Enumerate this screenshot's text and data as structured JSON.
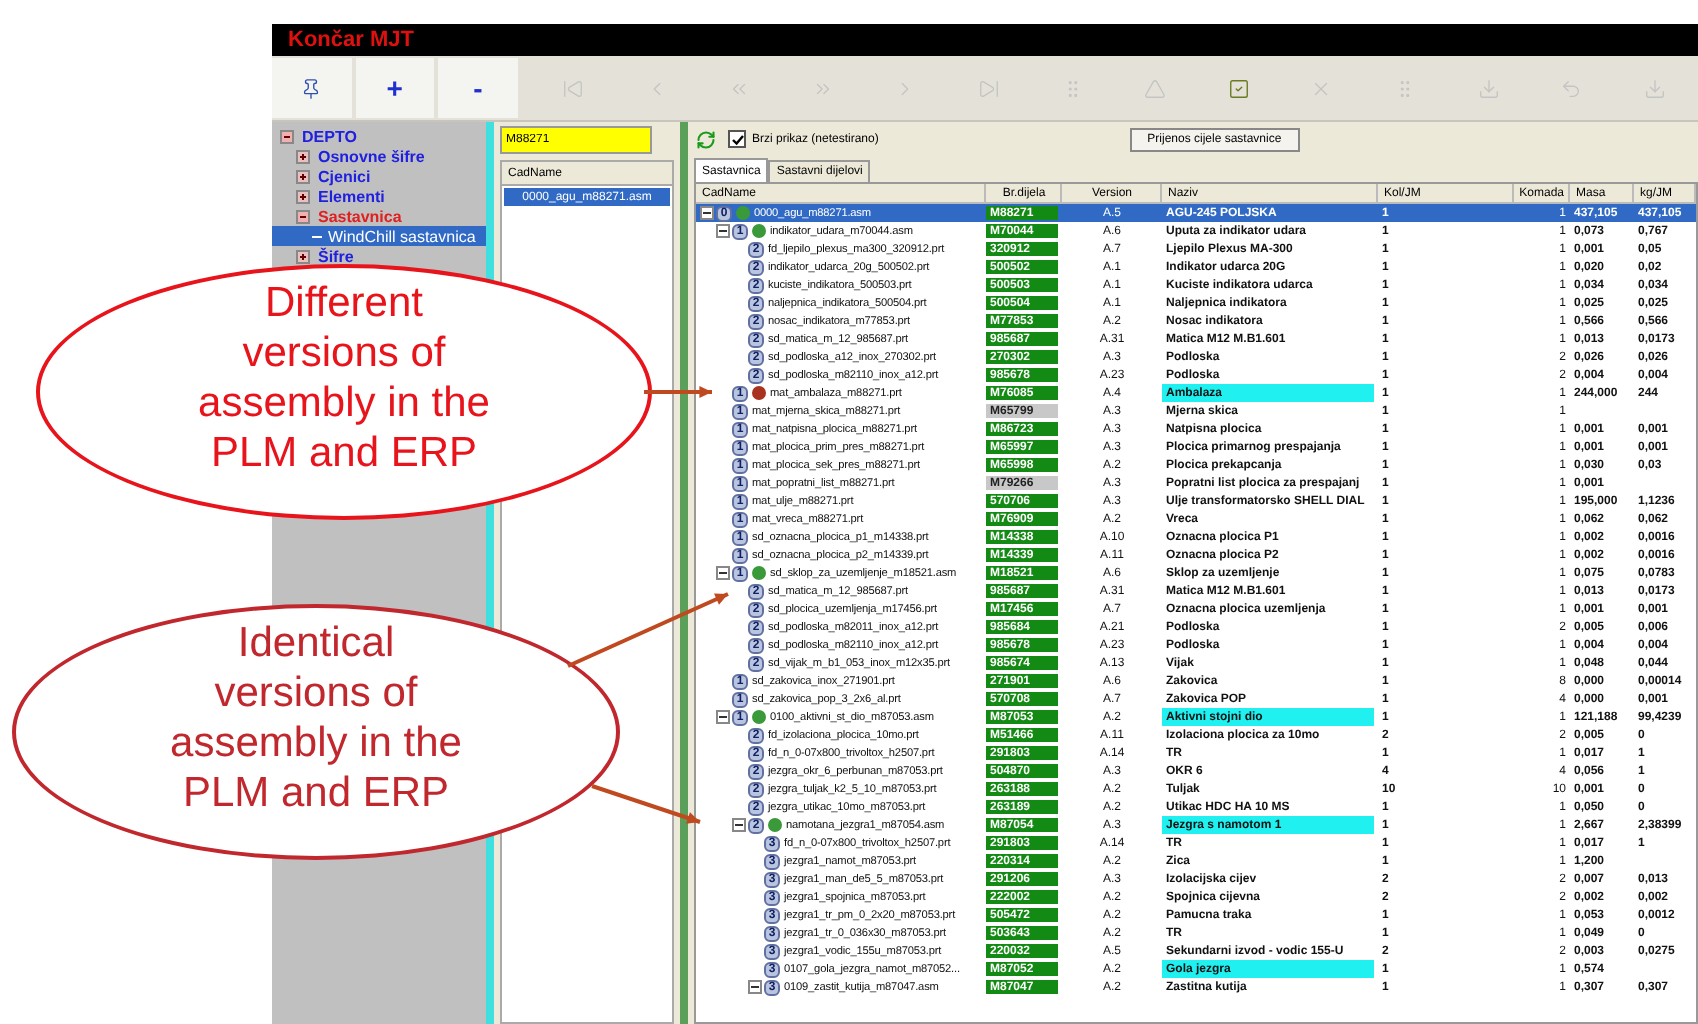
{
  "window": {
    "title": "Končar MJT"
  },
  "toolbar": [
    {
      "kind": "icon",
      "disabled": false
    },
    {
      "kind": "text",
      "label": "+",
      "disabled": false
    },
    {
      "kind": "text",
      "label": "-",
      "disabled": false
    },
    {
      "kind": "icon",
      "disabled": true
    },
    {
      "kind": "icon",
      "disabled": true
    },
    {
      "kind": "icon",
      "disabled": true
    },
    {
      "kind": "icon",
      "disabled": true
    },
    {
      "kind": "icon",
      "disabled": true
    },
    {
      "kind": "icon",
      "disabled": true
    },
    {
      "kind": "icon",
      "disabled": true
    },
    {
      "kind": "icon",
      "disabled": true
    },
    {
      "kind": "icon",
      "disabled": false
    },
    {
      "kind": "icon",
      "disabled": true
    },
    {
      "kind": "icon",
      "disabled": true
    },
    {
      "kind": "icon",
      "disabled": true
    },
    {
      "kind": "icon",
      "disabled": true
    },
    {
      "kind": "icon",
      "disabled": true
    }
  ],
  "tree": [
    {
      "label": "DEPTO",
      "expanded": true,
      "selected": false,
      "children": [
        {
          "label": "Osnovne šifre",
          "expanded": false,
          "selected": false
        },
        {
          "label": "Cjenici",
          "expanded": false,
          "selected": false
        },
        {
          "label": "Elementi",
          "expanded": false,
          "selected": false
        },
        {
          "label": "Sastavnica",
          "expanded": true,
          "selected": false,
          "active": true,
          "children": [
            {
              "label": "WindChill sastavnica",
              "selected": true
            }
          ]
        },
        {
          "label": "Šifre",
          "expanded": false,
          "selected": false
        }
      ]
    }
  ],
  "search": {
    "value": "M88271"
  },
  "file_list": {
    "header": "CadName",
    "items": [
      {
        "label": "0000_agu_m88271.asm",
        "selected": true
      }
    ]
  },
  "options": {
    "fast_view": {
      "label": "Brzi prikaz (netestirano)",
      "checked": true
    },
    "transfer_button": "Prijenos cijele sastavnice"
  },
  "tabs": [
    {
      "label": "Sastavnica",
      "selected": true
    },
    {
      "label": "Sastavni dijelovi",
      "selected": false
    }
  ],
  "table": {
    "columns": [
      "CadName",
      "Br.dijela",
      "Version",
      "Naziv",
      "Kol/JM",
      "Komada",
      "Masa",
      "kg/JM"
    ],
    "rows": [
      {
        "badge": "0",
        "cad_name": "0000_agu_m88271.asm",
        "part_no": "M88271",
        "version": "A.5",
        "name": "AGU-245 POLJSKA",
        "qty_uom": "1",
        "pieces": "1",
        "mass": "437,105",
        "kg_per_uom": "437,105",
        "in_erp": true,
        "highlighted": false,
        "selected": true,
        "expanded": true,
        "color": "#3a9a3a",
        "children": [
          {
            "badge": "1",
            "cad_name": "indikator_udara_m70044.asm",
            "part_no": "M70044",
            "version": "A.6",
            "name": "Uputa za indikator udara",
            "qty_uom": "1",
            "pieces": "1",
            "mass": "0,073",
            "kg_per_uom": "0,767",
            "in_erp": true,
            "highlighted": false,
            "selected": false,
            "expanded": true,
            "color": "#3a9a3a",
            "children": [
              {
                "badge": "2",
                "cad_name": "fd_ljepilo_plexus_ma300_320912.prt",
                "part_no": "320912",
                "version": "A.7",
                "name": "Ljepilo Plexus MA-300",
                "qty_uom": "1",
                "pieces": "1",
                "mass": "0,001",
                "kg_per_uom": "0,05",
                "in_erp": true,
                "highlighted": false,
                "selected": false
              },
              {
                "badge": "2",
                "cad_name": "indikator_udarca_20g_500502.prt",
                "part_no": "500502",
                "version": "A.1",
                "name": "Indikator udarca 20G",
                "qty_uom": "1",
                "pieces": "1",
                "mass": "0,020",
                "kg_per_uom": "0,02",
                "in_erp": true,
                "highlighted": false,
                "selected": false
              },
              {
                "badge": "2",
                "cad_name": "kuciste_indikatora_500503.prt",
                "part_no": "500503",
                "version": "A.1",
                "name": "Kuciste indikatora udarca",
                "qty_uom": "1",
                "pieces": "1",
                "mass": "0,034",
                "kg_per_uom": "0,034",
                "in_erp": true,
                "highlighted": false,
                "selected": false
              },
              {
                "badge": "2",
                "cad_name": "naljepnica_indikatora_500504.prt",
                "part_no": "500504",
                "version": "A.1",
                "name": "Naljepnica indikatora",
                "qty_uom": "1",
                "pieces": "1",
                "mass": "0,025",
                "kg_per_uom": "0,025",
                "in_erp": true,
                "highlighted": false,
                "selected": false
              },
              {
                "badge": "2",
                "cad_name": "nosac_indikatora_m77853.prt",
                "part_no": "M77853",
                "version": "A.2",
                "name": "Nosac indikatora",
                "qty_uom": "1",
                "pieces": "1",
                "mass": "0,566",
                "kg_per_uom": "0,566",
                "in_erp": true,
                "highlighted": false,
                "selected": false
              },
              {
                "badge": "2",
                "cad_name": "sd_matica_m_12_985687.prt",
                "part_no": "985687",
                "version": "A.31",
                "name": "Matica M12 M.B1.601",
                "qty_uom": "1",
                "pieces": "1",
                "mass": "0,013",
                "kg_per_uom": "0,0173",
                "in_erp": true,
                "highlighted": false,
                "selected": false
              },
              {
                "badge": "2",
                "cad_name": "sd_podloska_a12_inox_270302.prt",
                "part_no": "270302",
                "version": "A.3",
                "name": "Podloska",
                "qty_uom": "1",
                "pieces": "2",
                "mass": "0,026",
                "kg_per_uom": "0,026",
                "in_erp": true,
                "highlighted": false,
                "selected": false
              },
              {
                "badge": "2",
                "cad_name": "sd_podloska_m82110_inox_a12.prt",
                "part_no": "985678",
                "version": "A.23",
                "name": "Podloska",
                "qty_uom": "1",
                "pieces": "2",
                "mass": "0,004",
                "kg_per_uom": "0,004",
                "in_erp": true,
                "highlighted": false,
                "selected": false
              }
            ]
          },
          {
            "badge": "1",
            "cad_name": "mat_ambalaza_m88271.prt",
            "part_no": "M76085",
            "version": "A.4",
            "name": "Ambalaza",
            "qty_uom": "1",
            "pieces": "1",
            "mass": "244,000",
            "kg_per_uom": "244",
            "in_erp": true,
            "highlighted": true,
            "selected": false,
            "color": "#a8321e"
          },
          {
            "badge": "1",
            "cad_name": "mat_mjerna_skica_m88271.prt",
            "part_no": "M65799",
            "version": "A.3",
            "name": "Mjerna skica",
            "qty_uom": "1",
            "pieces": "1",
            "in_erp": false,
            "highlighted": false,
            "selected": false
          },
          {
            "badge": "1",
            "cad_name": "mat_natpisna_plocica_m88271.prt",
            "part_no": "M86723",
            "version": "A.3",
            "name": "Natpisna plocica",
            "qty_uom": "1",
            "pieces": "1",
            "mass": "0,001",
            "kg_per_uom": "0,001",
            "in_erp": true,
            "highlighted": false,
            "selected": false
          },
          {
            "badge": "1",
            "cad_name": "mat_plocica_prim_pres_m88271.prt",
            "part_no": "M65997",
            "version": "A.3",
            "name": "Plocica primarnog prespajanja",
            "qty_uom": "1",
            "pieces": "1",
            "mass": "0,001",
            "kg_per_uom": "0,001",
            "in_erp": true,
            "highlighted": false,
            "selected": false
          },
          {
            "badge": "1",
            "cad_name": "mat_plocica_sek_pres_m88271.prt",
            "part_no": "M65998",
            "version": "A.2",
            "name": "Plocica prekapcanja",
            "qty_uom": "1",
            "pieces": "1",
            "mass": "0,030",
            "kg_per_uom": "0,03",
            "in_erp": true,
            "highlighted": false,
            "selected": false
          },
          {
            "badge": "1",
            "cad_name": "mat_popratni_list_m88271.prt",
            "part_no": "M79266",
            "version": "A.3",
            "name": "Popratni list plocica za prespajanj",
            "qty_uom": "1",
            "pieces": "1",
            "mass": "0,001",
            "in_erp": false,
            "highlighted": false,
            "selected": false
          },
          {
            "badge": "1",
            "cad_name": "mat_ulje_m88271.prt",
            "part_no": "570706",
            "version": "A.3",
            "name": "Ulje transformatorsko SHELL DIAL",
            "qty_uom": "1",
            "pieces": "1",
            "mass": "195,000",
            "kg_per_uom": "1,1236",
            "in_erp": true,
            "highlighted": false,
            "selected": false
          },
          {
            "badge": "1",
            "cad_name": "mat_vreca_m88271.prt",
            "part_no": "M76909",
            "version": "A.2",
            "name": "Vreca",
            "qty_uom": "1",
            "pieces": "1",
            "mass": "0,062",
            "kg_per_uom": "0,062",
            "in_erp": true,
            "highlighted": false,
            "selected": false
          },
          {
            "badge": "1",
            "cad_name": "sd_oznacna_plocica_p1_m14338.prt",
            "part_no": "M14338",
            "version": "A.10",
            "name": "Oznacna plocica P1",
            "qty_uom": "1",
            "pieces": "1",
            "mass": "0,002",
            "kg_per_uom": "0,0016",
            "in_erp": true,
            "highlighted": false,
            "selected": false
          },
          {
            "badge": "1",
            "cad_name": "sd_oznacna_plocica_p2_m14339.prt",
            "part_no": "M14339",
            "version": "A.11",
            "name": "Oznacna plocica P2",
            "qty_uom": "1",
            "pieces": "1",
            "mass": "0,002",
            "kg_per_uom": "0,0016",
            "in_erp": true,
            "highlighted": false,
            "selected": false
          },
          {
            "badge": "1",
            "cad_name": "sd_sklop_za_uzemljenje_m18521.asm",
            "part_no": "M18521",
            "version": "A.6",
            "name": "Sklop za uzemljenje",
            "qty_uom": "1",
            "pieces": "1",
            "mass": "0,075",
            "kg_per_uom": "0,0783",
            "in_erp": true,
            "highlighted": false,
            "selected": false,
            "expanded": true,
            "color": "#3a9a3a",
            "children": [
              {
                "badge": "2",
                "cad_name": "sd_matica_m_12_985687.prt",
                "part_no": "985687",
                "version": "A.31",
                "name": "Matica M12 M.B1.601",
                "qty_uom": "1",
                "pieces": "1",
                "mass": "0,013",
                "kg_per_uom": "0,0173",
                "in_erp": true,
                "highlighted": false,
                "selected": false
              },
              {
                "badge": "2",
                "cad_name": "sd_plocica_uzemljenja_m17456.prt",
                "part_no": "M17456",
                "version": "A.7",
                "name": "Oznacna plocica uzemljenja",
                "qty_uom": "1",
                "pieces": "1",
                "mass": "0,001",
                "kg_per_uom": "0,001",
                "in_erp": true,
                "highlighted": false,
                "selected": false
              },
              {
                "badge": "2",
                "cad_name": "sd_podloska_m82011_inox_a12.prt",
                "part_no": "985684",
                "version": "A.21",
                "name": "Podloska",
                "qty_uom": "1",
                "pieces": "2",
                "mass": "0,005",
                "kg_per_uom": "0,006",
                "in_erp": true,
                "highlighted": false,
                "selected": false
              },
              {
                "badge": "2",
                "cad_name": "sd_podloska_m82110_inox_a12.prt",
                "part_no": "985678",
                "version": "A.23",
                "name": "Podloska",
                "qty_uom": "1",
                "pieces": "1",
                "mass": "0,004",
                "kg_per_uom": "0,004",
                "in_erp": true,
                "highlighted": false,
                "selected": false
              },
              {
                "badge": "2",
                "cad_name": "sd_vijak_m_b1_053_inox_m12x35.prt",
                "part_no": "985674",
                "version": "A.13",
                "name": "Vijak",
                "qty_uom": "1",
                "pieces": "1",
                "mass": "0,048",
                "kg_per_uom": "0,044",
                "in_erp": true,
                "highlighted": false,
                "selected": false
              }
            ]
          },
          {
            "badge": "1",
            "cad_name": "sd_zakovica_inox_271901.prt",
            "part_no": "271901",
            "version": "A.6",
            "name": "Zakovica",
            "qty_uom": "1",
            "pieces": "8",
            "mass": "0,000",
            "kg_per_uom": "0,00014",
            "in_erp": true,
            "highlighted": false,
            "selected": false
          },
          {
            "badge": "1",
            "cad_name": "sd_zakovica_pop_3_2x6_al.prt",
            "part_no": "570708",
            "version": "A.7",
            "name": "Zakovica POP",
            "qty_uom": "1",
            "pieces": "4",
            "mass": "0,000",
            "kg_per_uom": "0,001",
            "in_erp": true,
            "highlighted": false,
            "selected": false
          },
          {
            "badge": "1",
            "cad_name": "0100_aktivni_st_dio_m87053.asm",
            "part_no": "M87053",
            "version": "A.2",
            "name": "Aktivni stojni dio",
            "qty_uom": "1",
            "pieces": "1",
            "mass": "121,188",
            "kg_per_uom": "99,4239",
            "in_erp": true,
            "highlighted": true,
            "selected": false,
            "expanded": true,
            "color": "#3a9a3a",
            "children": [
              {
                "badge": "2",
                "cad_name": "fd_izolaciona_plocica_10mo.prt",
                "part_no": "M51466",
                "version": "A.11",
                "name": "Izolaciona plocica za 10mo",
                "qty_uom": "2",
                "pieces": "2",
                "mass": "0,005",
                "kg_per_uom": "0",
                "in_erp": true,
                "highlighted": false,
                "selected": false
              },
              {
                "badge": "2",
                "cad_name": "fd_n_0-07x800_trivoltox_h2507.prt",
                "part_no": "291803",
                "version": "A.14",
                "name": "TR",
                "qty_uom": "1",
                "pieces": "1",
                "mass": "0,017",
                "kg_per_uom": "1",
                "in_erp": true,
                "highlighted": false,
                "selected": false
              },
              {
                "badge": "2",
                "cad_name": "jezgra_okr_6_perbunan_m87053.prt",
                "part_no": "504870",
                "version": "A.3",
                "name": "OKR 6",
                "qty_uom": "4",
                "pieces": "4",
                "mass": "0,056",
                "kg_per_uom": "1",
                "in_erp": true,
                "highlighted": false,
                "selected": false
              },
              {
                "badge": "2",
                "cad_name": "jezgra_tuljak_k2_5_10_m87053.prt",
                "part_no": "263188",
                "version": "A.2",
                "name": "Tuljak",
                "qty_uom": "10",
                "pieces": "10",
                "mass": "0,001",
                "kg_per_uom": "0",
                "in_erp": true,
                "highlighted": false,
                "selected": false
              },
              {
                "badge": "2",
                "cad_name": "jezgra_utikac_10mo_m87053.prt",
                "part_no": "263189",
                "version": "A.2",
                "name": "Utikac HDC HA 10 MS",
                "qty_uom": "1",
                "pieces": "1",
                "mass": "0,050",
                "kg_per_uom": "0",
                "in_erp": true,
                "highlighted": false,
                "selected": false
              },
              {
                "badge": "2",
                "cad_name": "namotana_jezgra1_m87054.asm",
                "part_no": "M87054",
                "version": "A.3",
                "name": "Jezgra s namotom 1",
                "qty_uom": "1",
                "pieces": "1",
                "mass": "2,667",
                "kg_per_uom": "2,38399",
                "in_erp": true,
                "highlighted": true,
                "selected": false,
                "expanded": true,
                "color": "#3a9a3a",
                "children": [
                  {
                    "badge": "3",
                    "cad_name": "fd_n_0-07x800_trivoltox_h2507.prt",
                    "part_no": "291803",
                    "version": "A.14",
                    "name": "TR",
                    "qty_uom": "1",
                    "pieces": "1",
                    "mass": "0,017",
                    "kg_per_uom": "1",
                    "in_erp": true,
                    "highlighted": false,
                    "selected": false
                  },
                  {
                    "badge": "3",
                    "cad_name": "jezgra1_namot_m87053.prt",
                    "part_no": "220314",
                    "version": "A.2",
                    "name": "Zica",
                    "qty_uom": "1",
                    "pieces": "1",
                    "mass": "1,200",
                    "in_erp": true,
                    "highlighted": false,
                    "selected": false
                  },
                  {
                    "badge": "3",
                    "cad_name": "jezgra1_man_de5_5_m87053.prt",
                    "part_no": "291206",
                    "version": "A.3",
                    "name": "Izolacijska cijev",
                    "qty_uom": "2",
                    "pieces": "2",
                    "mass": "0,007",
                    "kg_per_uom": "0,013",
                    "in_erp": true,
                    "highlighted": false,
                    "selected": false
                  },
                  {
                    "badge": "3",
                    "cad_name": "jezgra1_spojnica_m87053.prt",
                    "part_no": "222002",
                    "version": "A.2",
                    "name": "Spojnica cijevna",
                    "qty_uom": "2",
                    "pieces": "2",
                    "mass": "0,002",
                    "kg_per_uom": "0,002",
                    "in_erp": true,
                    "highlighted": false,
                    "selected": false
                  },
                  {
                    "badge": "3",
                    "cad_name": "jezgra1_tr_pm_0_2x20_m87053.prt",
                    "part_no": "505472",
                    "version": "A.2",
                    "name": "Pamucna traka",
                    "qty_uom": "1",
                    "pieces": "1",
                    "mass": "0,053",
                    "kg_per_uom": "0,0012",
                    "in_erp": true,
                    "highlighted": false,
                    "selected": false
                  },
                  {
                    "badge": "3",
                    "cad_name": "jezgra1_tr_0_036x30_m87053.prt",
                    "part_no": "503643",
                    "version": "A.2",
                    "name": "TR",
                    "qty_uom": "1",
                    "pieces": "1",
                    "mass": "0,049",
                    "kg_per_uom": "0",
                    "in_erp": true,
                    "highlighted": false,
                    "selected": false
                  },
                  {
                    "badge": "3",
                    "cad_name": "jezgra1_vodic_155u_m87053.prt",
                    "part_no": "220032",
                    "version": "A.5",
                    "name": "Sekundarni izvod - vodic 155-U",
                    "qty_uom": "2",
                    "pieces": "2",
                    "mass": "0,003",
                    "kg_per_uom": "0,0275",
                    "in_erp": true,
                    "highlighted": false,
                    "selected": false
                  },
                  {
                    "badge": "3",
                    "cad_name": "0107_gola_jezgra_namot_m87052...",
                    "part_no": "M87052",
                    "version": "A.2",
                    "name": "Gola jezgra",
                    "qty_uom": "1",
                    "pieces": "1",
                    "mass": "0,574",
                    "in_erp": true,
                    "highlighted": true,
                    "selected": false
                  },
                  {
                    "badge": "3",
                    "cad_name": "0109_zastit_kutija_m87047.asm",
                    "part_no": "M87047",
                    "version": "A.2",
                    "name": "Zastitna kutija",
                    "qty_uom": "1",
                    "pieces": "1",
                    "mass": "0,307",
                    "kg_per_uom": "0,307",
                    "in_erp": true,
                    "highlighted": false,
                    "selected": false,
                    "expanded": true
                  }
                ]
              }
            ]
          }
        ]
      }
    ]
  },
  "callouts": [
    {
      "lines": [
        "Different",
        "versions of",
        "assembly in the",
        "PLM and ERP"
      ],
      "color": "#e8141c"
    },
    {
      "lines": [
        "Identical",
        "versions of",
        "assembly in the",
        "PLM and ERP"
      ],
      "color": "#c0282e"
    }
  ]
}
